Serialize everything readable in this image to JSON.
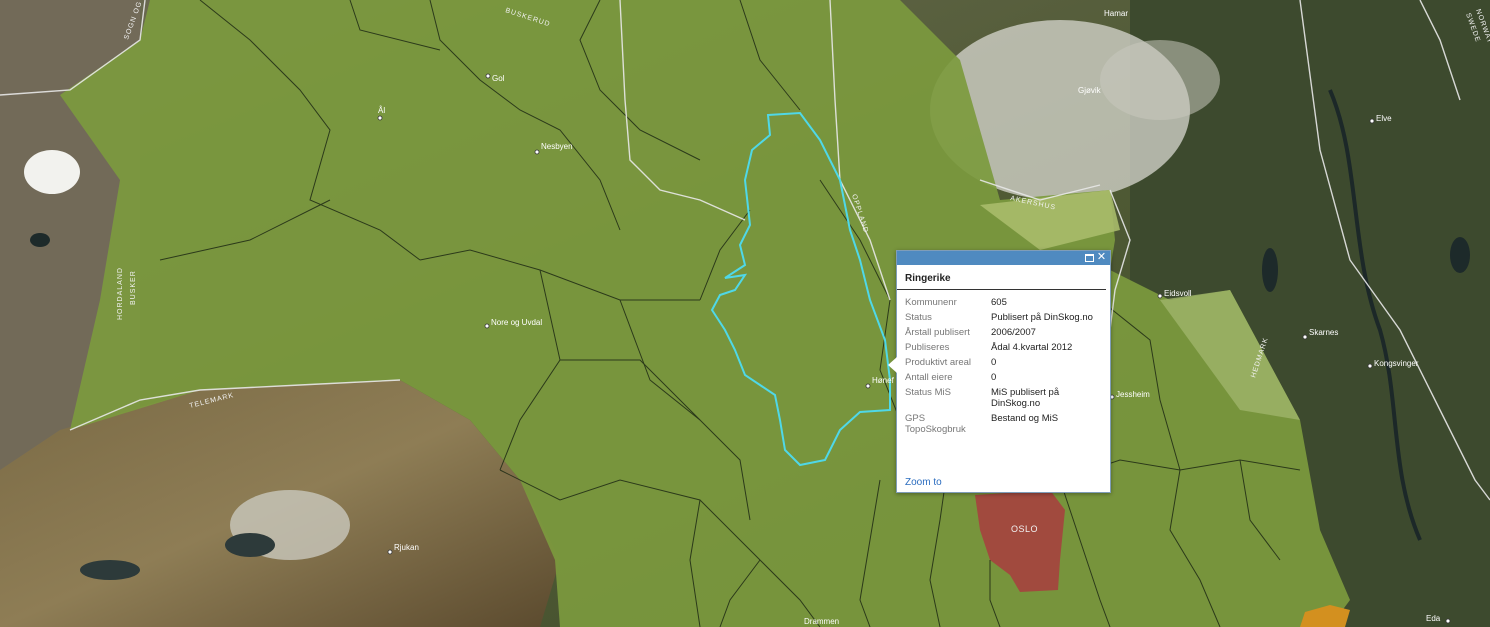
{
  "map": {
    "places": {
      "gol": "Gol",
      "al": "Ål",
      "nesbyen": "Nesbyen",
      "nore_uvdal": "Nore og Uvdal",
      "rjukan": "Rjukan",
      "drammen": "Drammen",
      "honefoss": "Hønef",
      "jessheim": "Jessheim",
      "eidsvoll": "Eidsvoll",
      "hamar": "Hamar",
      "gjovik": "Gjøvik",
      "elverum": "Elve",
      "skarnes": "Skarnes",
      "kongsvinger": "Kongsvinger",
      "eda": "Eda"
    },
    "regions": {
      "oslo": "OSLO",
      "hedmark": "HEDMARK",
      "telemark": "TELEMARK",
      "buskerud_top": "BUSKERUD",
      "buskerud_west": "BUSKER",
      "hordaland": "HORDALAND",
      "oppland": "OPPLAND",
      "akershus": "AKERSHUS",
      "norway_edge": "NORWAY",
      "sweden_edge": "SWEDE",
      "sogn": "SOGN OG"
    },
    "colors": {
      "forest_overlay": "#7c9a3e",
      "oslo": "#a14a3e",
      "highlight_boundary": "#4fd8e8",
      "orange_area": "#d3901f"
    }
  },
  "popup": {
    "title": "Ringerike",
    "fields": [
      {
        "key": "Kommunenr",
        "value": "605"
      },
      {
        "key": "Status",
        "value": "Publisert på DinSkog.no"
      },
      {
        "key": "Årstall publisert",
        "value": "2006/2007"
      },
      {
        "key": "Publiseres",
        "value": "Ådal 4.kvartal 2012"
      },
      {
        "key": "Produktivt areal",
        "value": "0"
      },
      {
        "key": "Antall eiere",
        "value": "0"
      },
      {
        "key": "Status MiS",
        "value": "MiS publisert på DinSkog.no"
      },
      {
        "key": "GPS TopoSkogbruk",
        "value": "Bestand og MiS"
      }
    ],
    "zoom_label": "Zoom to",
    "close_glyph": "✕"
  }
}
